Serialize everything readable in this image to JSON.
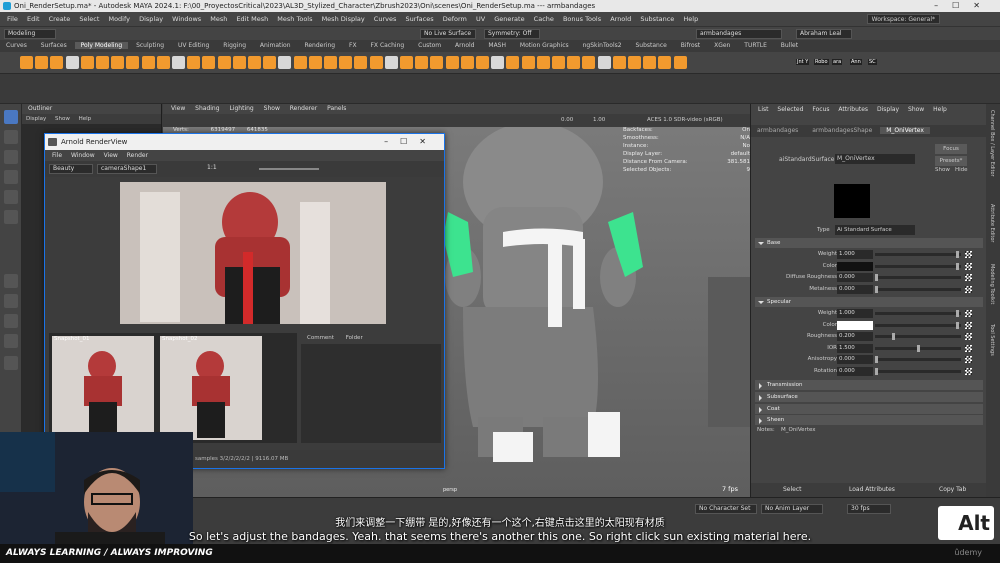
{
  "window": {
    "title": "Oni_RenderSetup.ma* - Autodesk MAYA 2024.1: F:\\00_ProyectosCritical\\2023\\AL3D_Stylized_Character\\Zbrush2023\\Oni\\scenes\\Oni_RenderSetup.ma  ---  armbandages"
  },
  "menubar": {
    "items": [
      "File",
      "Edit",
      "Create",
      "Select",
      "Modify",
      "Display",
      "Windows",
      "Mesh",
      "Edit Mesh",
      "Mesh Tools",
      "Mesh Display",
      "Curves",
      "Surfaces",
      "Deform",
      "UV",
      "Generate",
      "Cache",
      "Bonus Tools",
      "Arnold",
      "Substance",
      "Help"
    ],
    "workspace": "Workspace: General*"
  },
  "statusline": {
    "mode": "Modeling",
    "live_surface": "No Live Surface",
    "symmetry": "Symmetry: Off",
    "object_name": "armbandages",
    "user": "Abraham Leal"
  },
  "shelf": {
    "tabs": [
      "Curves",
      "Surfaces",
      "Poly Modeling",
      "Sculpting",
      "UV Editing",
      "Rigging",
      "Animation",
      "Rendering",
      "FX",
      "FX Caching",
      "Custom",
      "Arnold",
      "MASH",
      "Motion Graphics",
      "ngSkinTools2",
      "Substance",
      "Bifrost",
      "XGen",
      "TURTLE",
      "Bullet"
    ],
    "active_tab": "Poly Modeling",
    "icon_color": "#f29a2e",
    "labels": [
      "Jnt Y",
      "Robo",
      "ara",
      "Ann",
      "SC"
    ]
  },
  "outliner": {
    "title": "Outliner",
    "menu": [
      "Display",
      "Show",
      "Help"
    ]
  },
  "viewport": {
    "menu": [
      "View",
      "Shading",
      "Lighting",
      "Show",
      "Renderer",
      "Panels"
    ],
    "exposure": "0.00",
    "gamma": "1.00",
    "colorspace": "ACES 1.0 SDR-video (sRGB)",
    "stats": [
      {
        "label": "Verts:",
        "v1": "6319497",
        "v2": "641835"
      },
      {
        "label": "Backfaces:",
        "v1": "On",
        "v2": ""
      },
      {
        "label": "Smoothness:",
        "v1": "N/A",
        "v2": ""
      },
      {
        "label": "Instance:",
        "v1": "No",
        "v2": ""
      },
      {
        "label": "Display Layer:",
        "v1": "default",
        "v2": ""
      },
      {
        "label": "Distance From Camera:",
        "v1": "381.581",
        "v2": ""
      },
      {
        "label": "Selected Objects:",
        "v1": "9",
        "v2": ""
      }
    ],
    "camera": "persp",
    "fps": "7 fps",
    "select_color": "#3de38f"
  },
  "renderview": {
    "title": "Arnold RenderView",
    "menu": [
      "File",
      "Window",
      "View",
      "Render"
    ],
    "aov": "Beauty",
    "camera": "cameraShape1",
    "ratio": "1:1",
    "snapshots": [
      "Snapshot_01",
      "Snapshot_02"
    ],
    "comment_tabs": [
      "Comment",
      "Folder"
    ],
    "status": "samples 3/2/2/2/2/2 | 9116.07 MB"
  },
  "attribute_editor": {
    "menu": [
      "List",
      "Selected",
      "Focus",
      "Attributes",
      "Display",
      "Show",
      "Help"
    ],
    "tabs": [
      "armbandages",
      "armbandagesShape",
      "M_OniVertex"
    ],
    "active_tab": "M_OniVertex",
    "node_type_label": "aiStandardSurface:",
    "node_name": "M_OniVertex",
    "focus": "Focus",
    "presets": "Presets*",
    "show": "Show",
    "hide": "Hide",
    "type_label": "Type",
    "type_value": "Ai Standard Surface",
    "sections": {
      "base": "Base",
      "specular": "Specular",
      "transmission": "Transmission",
      "subsurface": "Subsurface",
      "coat": "Coat",
      "sheen": "Sheen"
    },
    "base_attrs": [
      {
        "label": "Weight",
        "value": "1.000",
        "level": 0.98
      },
      {
        "label": "Color",
        "value": "",
        "level": 0.98
      },
      {
        "label": "Diffuse Roughness",
        "value": "0.000",
        "level": 0.0
      },
      {
        "label": "Metalness",
        "value": "0.000",
        "level": 0.0
      }
    ],
    "spec_attrs": [
      {
        "label": "Weight",
        "value": "1.000",
        "level": 0.98
      },
      {
        "label": "Color",
        "value": "",
        "level": 0.98
      },
      {
        "label": "Roughness",
        "value": "0.200",
        "level": 0.2
      },
      {
        "label": "IOR",
        "value": "1.500",
        "level": 0.5
      },
      {
        "label": "Anisotropy",
        "value": "0.000",
        "level": 0.0
      },
      {
        "label": "Rotation",
        "value": "0.000",
        "level": 0.0
      }
    ],
    "notes_label": "Notes:",
    "notes_value": "M_OniVertex",
    "buttons": [
      "Select",
      "Load Attributes",
      "Copy Tab"
    ]
  },
  "edge_tabs": [
    "Channel Box / Layer Editor",
    "Attribute Editor",
    "Modeling Toolkit",
    "Tool Settings"
  ],
  "timeline": {
    "character_set": "No Character Set",
    "anim_layer": "No Anim Layer",
    "fps": "30 fps"
  },
  "subtitles": {
    "zh": "我们来调整一下绷带 是的,好像还有一个这个,右键点击这里的太阳现有材质",
    "en": "So let's adjust the bandages. Yeah. that seems there's another this one. So right click sun existing material here."
  },
  "banner": {
    "text": "ALWAYS LEARNING / ALWAYS IMPROVING",
    "brand": "ûdemy"
  },
  "watermark": "Alt"
}
